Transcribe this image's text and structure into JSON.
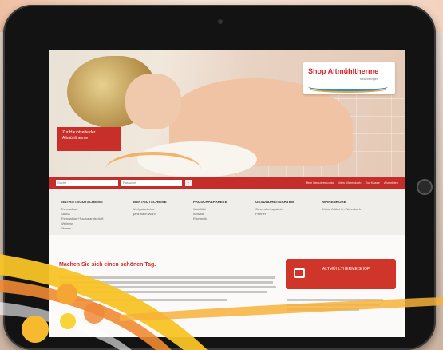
{
  "shop_logo": {
    "title": "Shop Altmühltherme",
    "subtitle": "Treuchtlingen"
  },
  "hero_callout": "Zur Hauptseite der Altmühltherme",
  "search": {
    "field1": "Suche",
    "field2": "Passwort"
  },
  "top_links": [
    "Mein Benutzerkonto",
    "Mein Warenkorb",
    "Zur Kasse",
    "Anmelden"
  ],
  "nav": [
    {
      "heading": "EINTRITTSGUTSCHEINE",
      "items": [
        "Thermalbad",
        "Sauna",
        "Thermalbad+Saunalandschaft",
        "Wellness",
        "Fitness"
      ]
    },
    {
      "heading": "WERTGUTSCHEINE",
      "items": [
        "Wertgutscheine",
        "ganz nach Wahl"
      ]
    },
    {
      "heading": "PAUSCHALPAKETE",
      "items": [
        "Wohlfühl",
        "Aktivität",
        "Romantik"
      ]
    },
    {
      "heading": "GESUNDHEITSARTEN",
      "items": [
        "Gesundheitspakete",
        "Partner"
      ]
    },
    {
      "heading": "WARENKORB",
      "items": [
        "Keine Artikel im Warenkorb"
      ]
    }
  ],
  "headline": "Machen Sie sich einen schönen Tag.",
  "shop_button": "ALTMÜHLTHERME SHOP",
  "colors": {
    "brand_red": "#c52d2a",
    "accent_orange": "#f4a24a",
    "accent_yellow": "#f7c325"
  }
}
